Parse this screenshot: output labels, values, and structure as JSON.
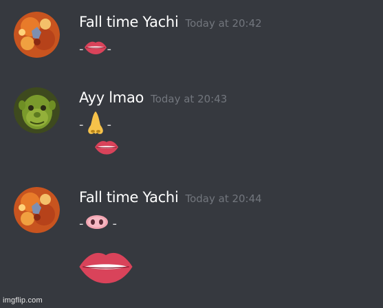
{
  "messages": [
    {
      "author": "Fall time Yachi",
      "timestamp": "Today at 20:42",
      "line1": {
        "before": "-",
        "emoji": "lips",
        "after": "-"
      }
    },
    {
      "author": "Ayy lmao",
      "timestamp": "Today at 20:43",
      "line1": {
        "before": "-",
        "emoji": "nose",
        "after": "-"
      },
      "line2": {
        "emoji": "lips"
      }
    },
    {
      "author": "Fall time Yachi",
      "timestamp": "Today at 20:44",
      "line1": {
        "before": "-",
        "emoji": "pig-nose",
        "after": "-"
      },
      "line2": {
        "emoji": "lips"
      }
    }
  ],
  "watermark": "imgflip.com",
  "colors": {
    "background": "#36393f",
    "username": "#ffffff",
    "timestamp": "#72767d",
    "text": "#dcddde"
  }
}
